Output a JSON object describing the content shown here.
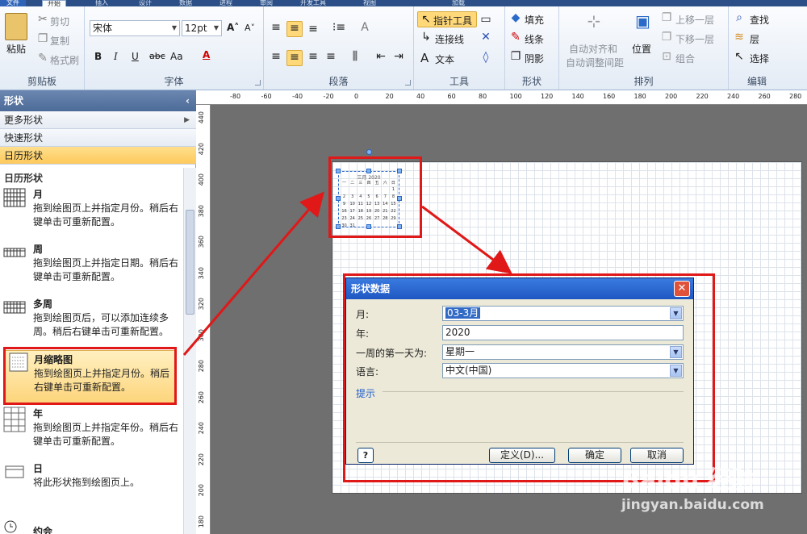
{
  "ribbon": {
    "tabs": [
      "文件",
      "开始",
      "插入",
      "设计",
      "数据",
      "进程",
      "审阅",
      "开发工具",
      "视图",
      "加载"
    ],
    "clipboard": {
      "title": "剪贴板",
      "paste": "粘贴",
      "cut": "剪切",
      "copy": "复制",
      "format_painter": "格式刷"
    },
    "font": {
      "title": "字体",
      "name": "宋体",
      "size": "12pt",
      "bold": "B",
      "italic": "I",
      "underline": "U",
      "strike": "abc",
      "case": "Aa",
      "color": "A"
    },
    "paragraph": {
      "title": "段落"
    },
    "tools": {
      "title": "工具",
      "pointer": "指针工具",
      "connector": "连接线",
      "text": "文本"
    },
    "shape": {
      "title": "形状",
      "fill": "填充",
      "line": "线条",
      "shadow": "阴影"
    },
    "arrange": {
      "title": "排列",
      "auto_align": "自动对齐和",
      "auto_space": "自动调整间距",
      "position": "位置",
      "bring_forward": "上移一层",
      "send_backward": "下移一层",
      "group": "组合"
    },
    "edit": {
      "title": "编辑",
      "find": "查找",
      "layers": "层",
      "select": "选择"
    }
  },
  "panel": {
    "title": "形状",
    "nav": [
      "更多形状",
      "快速形状",
      "日历形状"
    ],
    "stencil_title": "日历形状",
    "shapes": [
      {
        "name": "月",
        "desc": "拖到绘图页上并指定月份。稍后右键单击可重新配置。"
      },
      {
        "name": "周",
        "desc": "拖到绘图页上并指定日期。稍后右键单击可重新配置。"
      },
      {
        "name": "多周",
        "desc": "拖到绘图页后，可以添加连续多周。稍后右键单击可重新配置。"
      },
      {
        "name": "月缩略图",
        "desc": "拖到绘图页上并指定月份。稍后右键单击可重新配置。"
      },
      {
        "name": "年",
        "desc": "拖到绘图页上并指定年份。稍后右键单击可重新配置。"
      },
      {
        "name": "日",
        "desc": "将此形状拖到绘图页上。"
      },
      {
        "name": "约会",
        "desc": ""
      }
    ]
  },
  "rulers": {
    "h": [
      "-80",
      "-60",
      "-40",
      "-20",
      "0",
      "20",
      "40",
      "60",
      "80",
      "100",
      "120",
      "140",
      "160",
      "180",
      "200",
      "220",
      "240",
      "260",
      "280"
    ],
    "v": [
      "440",
      "420",
      "400",
      "380",
      "360",
      "340",
      "320",
      "300",
      "280",
      "260",
      "240",
      "220",
      "200",
      "180"
    ]
  },
  "calendar_thumb": {
    "title": "三月 2020",
    "header": [
      "一",
      "二",
      "三",
      "四",
      "五",
      "六",
      "日"
    ],
    "rows": [
      [
        "",
        "",
        "",
        "",
        "",
        "",
        "1"
      ],
      [
        "2",
        "3",
        "4",
        "5",
        "6",
        "7",
        "8"
      ],
      [
        "9",
        "10",
        "11",
        "12",
        "13",
        "14",
        "15"
      ],
      [
        "16",
        "17",
        "18",
        "19",
        "20",
        "21",
        "22"
      ],
      [
        "23",
        "24",
        "25",
        "26",
        "27",
        "28",
        "29"
      ],
      [
        "30",
        "31",
        "",
        "",
        "",
        "",
        ""
      ]
    ]
  },
  "dialog": {
    "title": "形状数据",
    "close": "✕",
    "fields": [
      {
        "label": "月:",
        "value": "03-3月"
      },
      {
        "label": "年:",
        "value": "2020"
      },
      {
        "label": "一周的第一天为:",
        "value": "星期一"
      },
      {
        "label": "语言:",
        "value": "中文(中国)"
      }
    ],
    "hint": "提示",
    "help": "?",
    "define": "定义(D)...",
    "ok": "确定",
    "cancel": "取消"
  },
  "watermark": {
    "brand": "Baidu 经验",
    "url": "jingyan.baidu.com"
  },
  "colors": {
    "annotation": "#e01818",
    "selection": "#fdc95c",
    "dialog_title": "#1f57c2"
  }
}
